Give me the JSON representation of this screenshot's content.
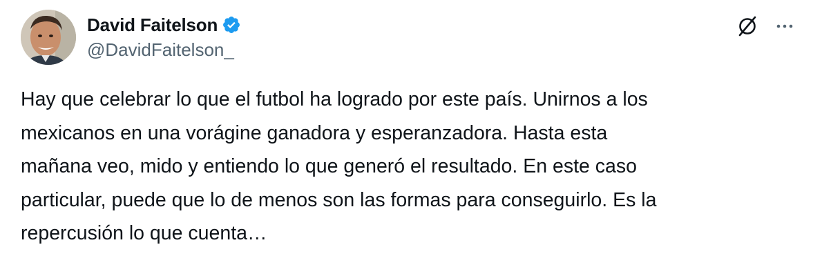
{
  "author": {
    "display_name": "David Faitelson",
    "handle": "@DavidFaitelson_",
    "verified": true,
    "verified_color": "#1d9bf0"
  },
  "actions": {
    "grok_icon": "grok-slash-icon",
    "more_icon": "more-dots-icon",
    "more_label": "···"
  },
  "tweet": {
    "lines": [
      "Hay que celebrar lo que el futbol ha logrado por este país. Unirnos a los",
      "mexicanos en una vorágine ganadora y esperanzadora. Hasta esta",
      "mañana veo, mido y entiendo lo que generó el resultado. En este caso",
      "particular, puede que lo de menos son las formas para conseguirlo. Es la",
      "repercusión lo que cuenta…"
    ]
  }
}
